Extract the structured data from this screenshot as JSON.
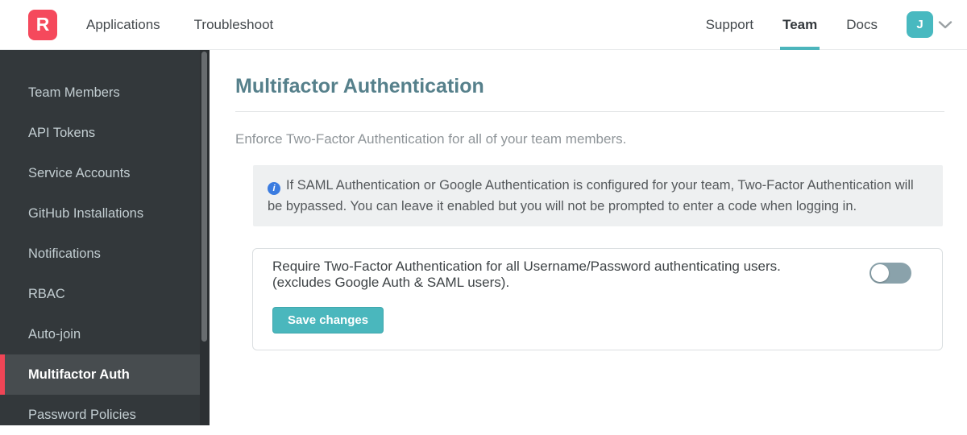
{
  "navbar": {
    "logo_letter": "R",
    "left_links": [
      {
        "label": "Applications"
      },
      {
        "label": "Troubleshoot"
      }
    ],
    "right_links": [
      {
        "label": "Support",
        "active": false
      },
      {
        "label": "Team",
        "active": true
      },
      {
        "label": "Docs",
        "active": false
      }
    ],
    "avatar_initial": "J"
  },
  "sidebar": {
    "items": [
      {
        "label": "Team Members",
        "active": false
      },
      {
        "label": "API Tokens",
        "active": false
      },
      {
        "label": "Service Accounts",
        "active": false
      },
      {
        "label": "GitHub Installations",
        "active": false
      },
      {
        "label": "Notifications",
        "active": false
      },
      {
        "label": "RBAC",
        "active": false
      },
      {
        "label": "Auto-join",
        "active": false
      },
      {
        "label": "Multifactor Auth",
        "active": true
      },
      {
        "label": "Password Policies",
        "active": false
      }
    ]
  },
  "main": {
    "title": "Multifactor Authentication",
    "intro": "Enforce Two-Factor Authentication for all of your team members.",
    "info_icon": "i",
    "info_note": "If SAML Authentication or Google Authentication is configured for your team, Two-Factor Authentication will be bypassed. You can leave it enabled but you will not be prompted to enter a code when logging in.",
    "setting": {
      "label_line1": "Require Two-Factor Authentication for all Username/Password authenticating users.",
      "label_line2": "(excludes Google Auth & SAML users).",
      "toggle_state": "off",
      "save_label": "Save changes"
    }
  },
  "colors": {
    "brand_red": "#f5495c",
    "accent_teal": "#4ab7bd",
    "active_red_bar": "#f04556",
    "info_blue": "#3b7ce0",
    "sidebar_bg": "#33383b",
    "heading_slate": "#56808b"
  }
}
